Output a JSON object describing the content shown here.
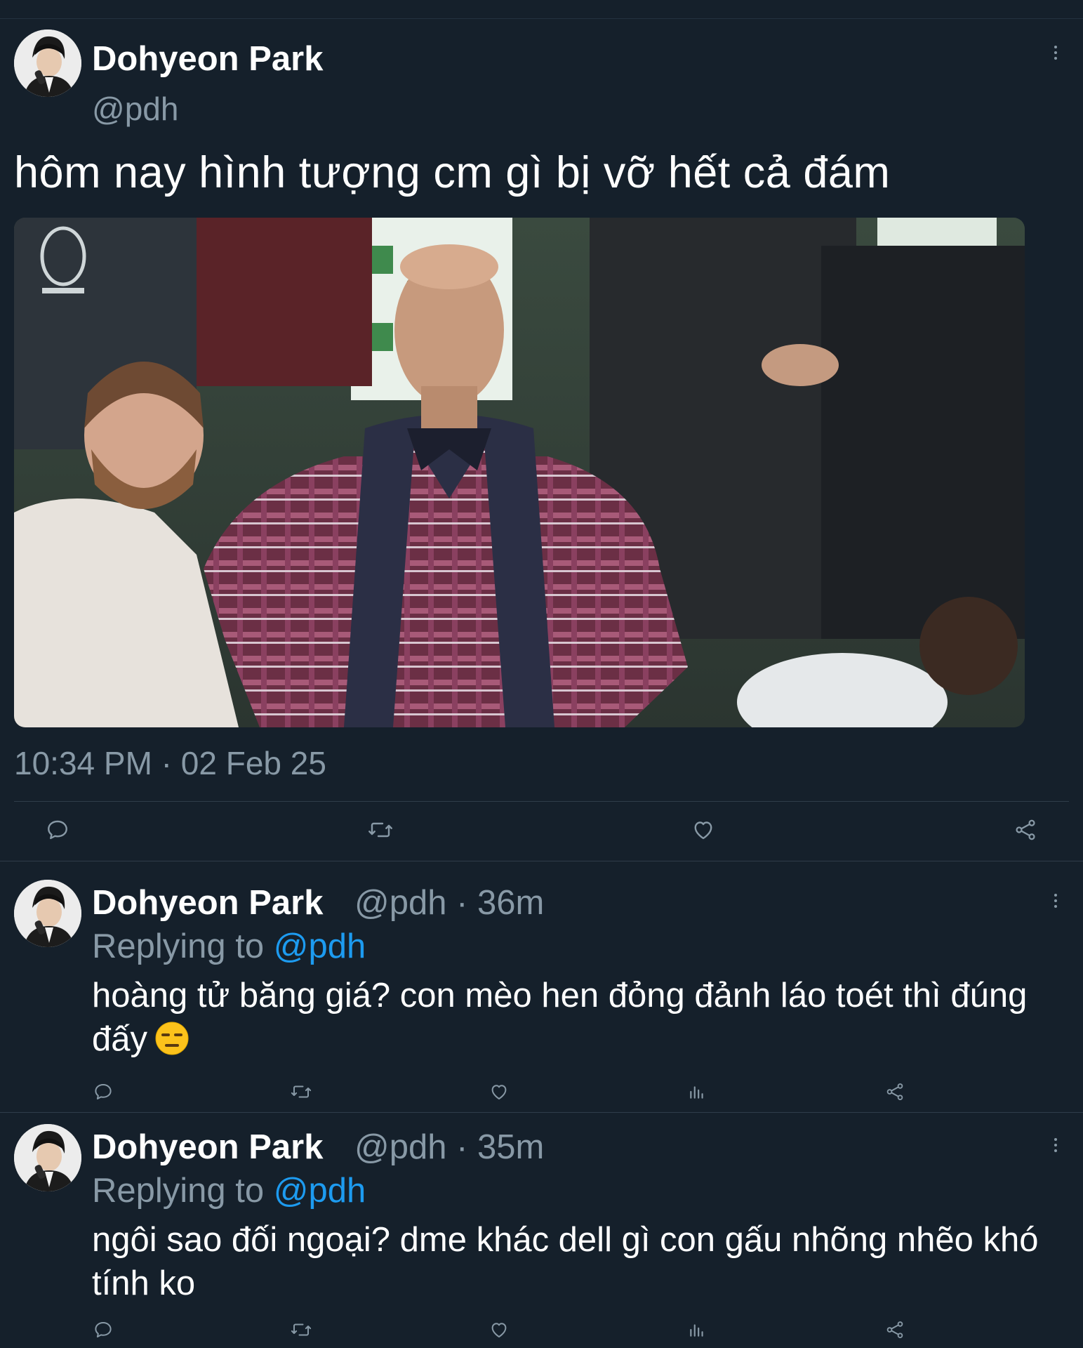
{
  "main_tweet": {
    "author_name": "Dohyeon Park",
    "author_handle": "@pdh",
    "text": "hôm nay hình tượng cm gì bị vỡ hết cả đám",
    "timestamp": "10:34 PM · 02 Feb 25",
    "actions": [
      "reply-icon",
      "retweet-icon",
      "like-icon",
      "share-icon"
    ]
  },
  "replies": [
    {
      "author_name": "Dohyeon Park",
      "author_handle": "@pdh",
      "meta": "@pdh · 36m",
      "replying_label": "Replying to",
      "replying_to": "@pdh",
      "text": "hoàng tử băng giá? con mèo hen đỏng đảnh láo toét thì đúng đấy",
      "emoji": "expressionless-face-emoji"
    },
    {
      "author_name": "Dohyeon Park",
      "author_handle": "@pdh",
      "meta": "@pdh · 35m",
      "replying_label": "Replying to",
      "replying_to": "@pdh",
      "text": "ngôi sao đối ngoại? dme khác dell gì con gấu nhõng nhẽo khó tính ko"
    }
  ],
  "colors": {
    "background": "#15202b",
    "secondary_text": "#8899a6",
    "link": "#1d9bf0",
    "divider": "#2f3d4a"
  }
}
